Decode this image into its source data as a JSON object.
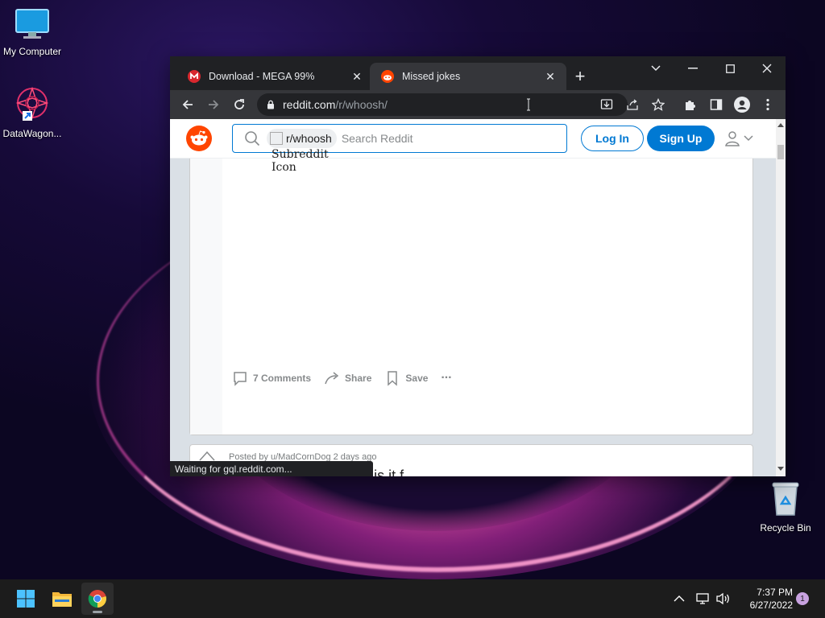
{
  "desktop": {
    "icons": [
      {
        "label": "My Computer"
      },
      {
        "label": "DataWagon..."
      },
      {
        "label": "Recycle Bin"
      }
    ]
  },
  "browser": {
    "tabs": [
      {
        "title": "Download - MEGA 99%",
        "active": false
      },
      {
        "title": "Missed jokes",
        "active": true
      }
    ],
    "url": {
      "host": "reddit.com",
      "path": "/r/whoosh/"
    },
    "status_text": "Waiting for gql.reddit.com..."
  },
  "reddit": {
    "search": {
      "chip_label": "r/whoosh",
      "chip_img_alt": "Subreddit Icon",
      "placeholder": "Search Reddit"
    },
    "login_label": "Log In",
    "signup_label": "Sign Up",
    "post": {
      "comments_label": "7 Comments",
      "share_label": "Share",
      "save_label": "Save",
      "more_label": "···"
    },
    "next_post": {
      "meta": "Posted by u/MadCornDog 2 days ago",
      "title": "...stood thi...  t lik  h  ...  his   it  f   ...  "
    }
  },
  "taskbar": {
    "time": "7:37 PM",
    "date": "6/27/2022",
    "notification_count": "1"
  },
  "colors": {
    "reddit_orange": "#ff4500",
    "reddit_blue": "#0079d3",
    "chrome_dark": "#202124",
    "chrome_toolbar": "#35363a"
  }
}
